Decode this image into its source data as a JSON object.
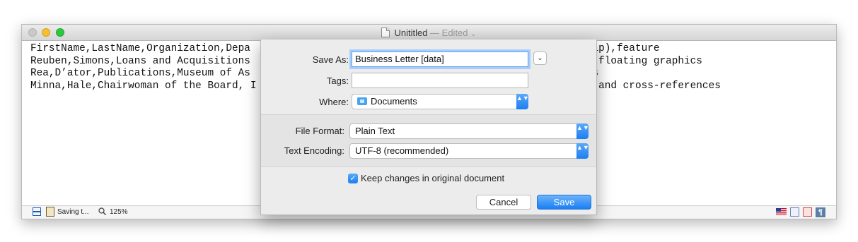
{
  "window": {
    "title": "Unititled",
    "edited": "— Edited",
    "title_chevron": "⌄"
  },
  "document": {
    "lines": [
      "FirstName,LastName,Organization,Depa                                            ),Address (zip),feature",
      "Reuben,Simons,Loans and Acquisitions                                            sco,CA,92999,floating graphics",
      "Rea,D’ator,Publications,Museum of As                                            4736,comments",
      "Minna,Hale,Chairwoman of the Board, I                                           47,bookmarks and cross-references"
    ]
  },
  "statusbar": {
    "saving": "Saving t...",
    "zoom": "125%",
    "paragraph_glyph": "¶"
  },
  "save_sheet": {
    "save_as_label": "Save As:",
    "save_as_value": "Business Letter [data]",
    "expand_glyph": "⌄",
    "tags_label": "Tags:",
    "tags_value": "",
    "where_label": "Where:",
    "where_value": "Documents",
    "file_format_label": "File Format:",
    "file_format_value": "Plain Text",
    "encoding_label": "Text Encoding:",
    "encoding_value": "UTF-8 (recommended)",
    "keep_changes_label": "Keep changes in original document",
    "keep_changes_checked": true,
    "check_glyph": "✓",
    "cancel_label": "Cancel",
    "save_label": "Save",
    "stepper_glyph": "▲▼"
  },
  "colors": {
    "accent": "#1d7ef2",
    "focus_ring": "#a9cdf9"
  }
}
